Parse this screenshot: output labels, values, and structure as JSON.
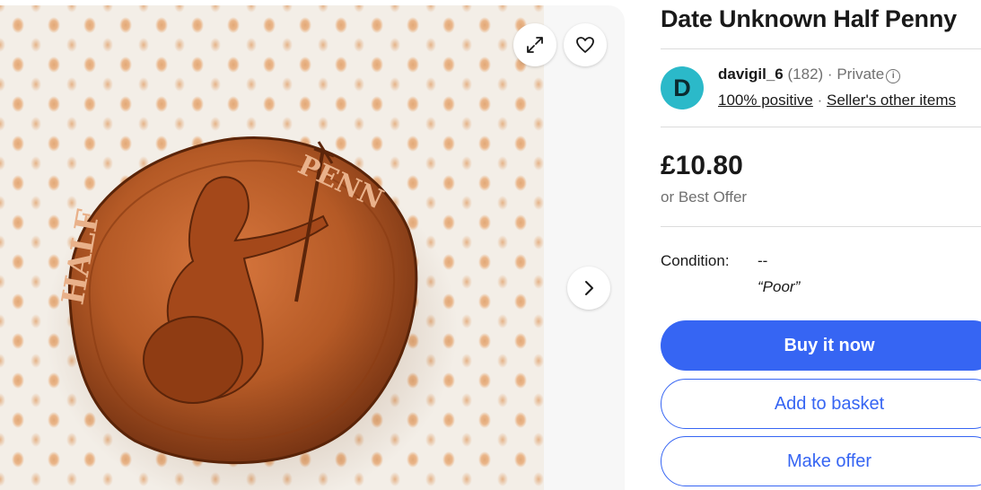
{
  "listing": {
    "title": "Date Unknown Half Penny",
    "image_alt": "Half penny coin photo"
  },
  "gallery": {
    "expand_icon": "expand-icon",
    "favorite_icon": "heart-icon",
    "next_icon": "chevron-right-icon"
  },
  "seller": {
    "avatar_letter": "D",
    "name": "davigil_6",
    "feedback_count": "(182)",
    "separator": "·",
    "type": "Private",
    "positive": "100% positive",
    "other_items": "Seller's other items"
  },
  "pricing": {
    "price": "£10.80",
    "offer_text": "or Best Offer"
  },
  "condition": {
    "label": "Condition:",
    "value": "--",
    "quote": "“Poor”"
  },
  "actions": {
    "buy_now": "Buy it now",
    "add_to_basket": "Add to basket",
    "make_offer": "Make offer"
  },
  "colors": {
    "accent": "#3665f3",
    "avatar": "#2bb9c9"
  }
}
